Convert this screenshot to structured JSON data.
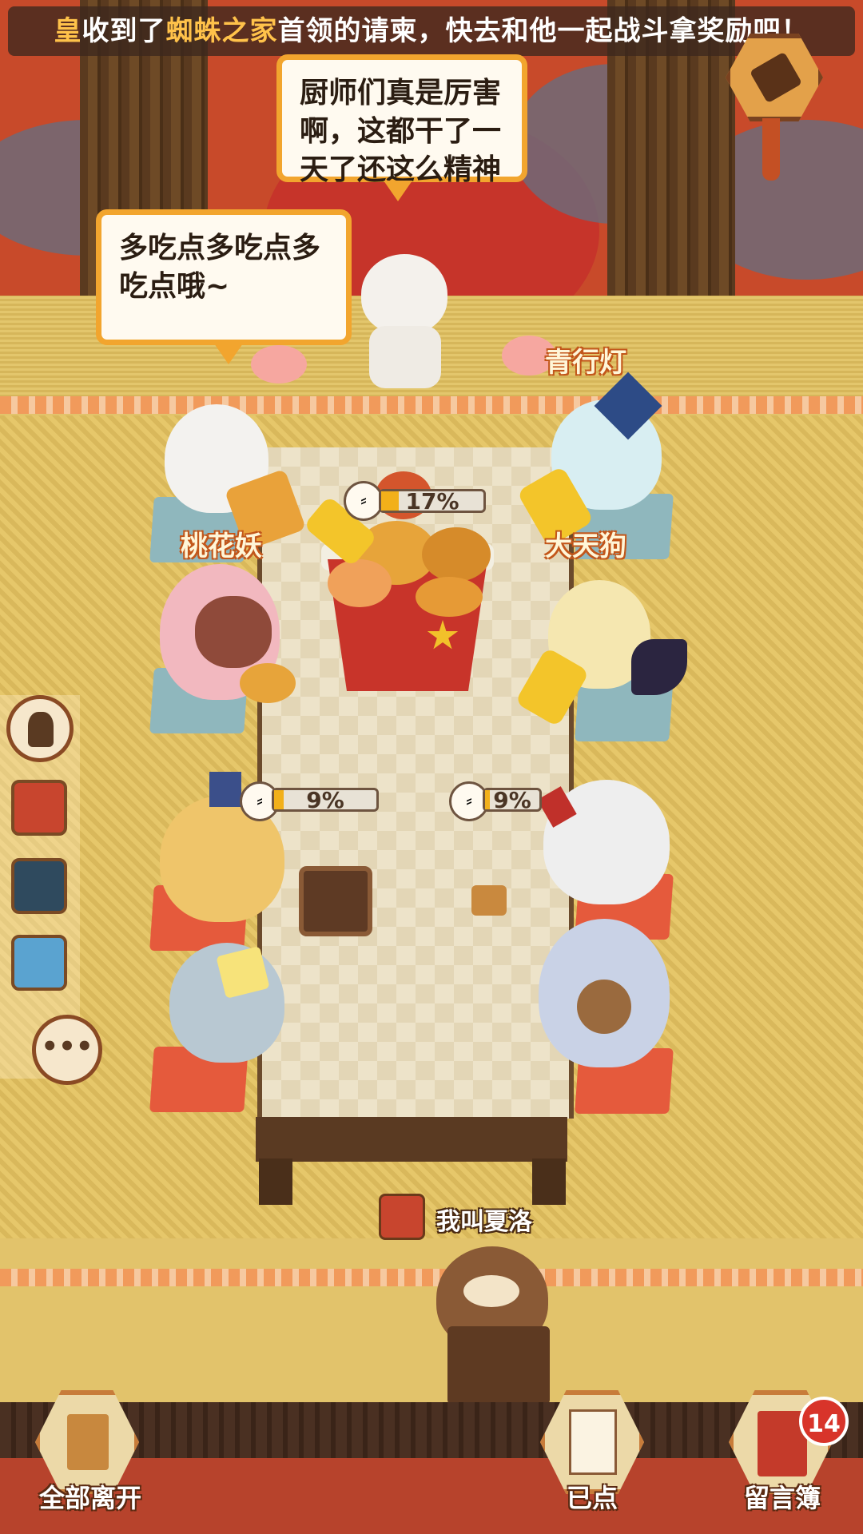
{
  "banner": {
    "left_frag": "皇",
    "text1": "收到了",
    "highlight": "蜘蛛之家",
    "text2": "首领的请柬，快去和他一起战斗拿奖励吧！"
  },
  "bubbles": {
    "chef_line": "厨师们真是厉害啊，这都干了一天了还这么精神",
    "guest_line": "多吃点多吃点多吃点哦~"
  },
  "characters": {
    "peach": "桃花妖",
    "seigyoto": "青行灯",
    "tengu": "大天狗"
  },
  "progress": {
    "center": {
      "label": "17%",
      "value": 0.17
    },
    "left": {
      "label": "9%",
      "value": 0.09
    },
    "right": {
      "label": "9%",
      "value": 0.09
    }
  },
  "host": {
    "name": "我叫夏洛"
  },
  "bottom": {
    "leave_all": "全部离开",
    "ordered": "已点",
    "guestbook": "留言簿",
    "guestbook_badge": "14"
  },
  "icons": {
    "side_top": "chef-hat-icon",
    "side_more": "more-icon",
    "top_right": "hammer-icon"
  },
  "colors": {
    "accent": "#f2a52e",
    "highlight": "#ffc24a",
    "badge": "#d8342a"
  }
}
